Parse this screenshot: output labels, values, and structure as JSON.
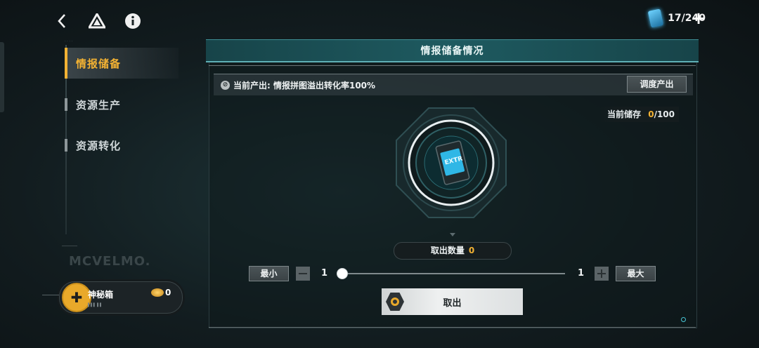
{
  "topbar": {
    "back_icon": "chevron-left-icon",
    "drive_icon": "triangle-logo-icon",
    "info_icon": "info-icon",
    "currency_count": "17/240",
    "plus_label": "+"
  },
  "sidebar": {
    "items": [
      {
        "label": "情报储备",
        "active": true
      },
      {
        "label": "资源生产",
        "active": false
      },
      {
        "label": "资源转化",
        "active": false
      }
    ],
    "watermark": "MCVELMO.",
    "mystery_box": {
      "name": "神秘箱",
      "count": "0"
    }
  },
  "panel": {
    "title": "情报储备情况",
    "current_output_label": "当前产出: 情报拼图溢出转化率100%",
    "schedule_button": "调度产出",
    "storage_label": "当前储存",
    "storage_current": "0",
    "storage_max": "/100",
    "emblem_label": "EXTR",
    "quantity_label": "取出数量",
    "quantity_value": "0",
    "min_button": "最小",
    "max_button": "最大",
    "min_value": "1",
    "max_value": "1",
    "slider_position": 0,
    "take_button": "取出"
  },
  "colors": {
    "accent": "#f3b233",
    "panel_header": "#1e5a60"
  }
}
